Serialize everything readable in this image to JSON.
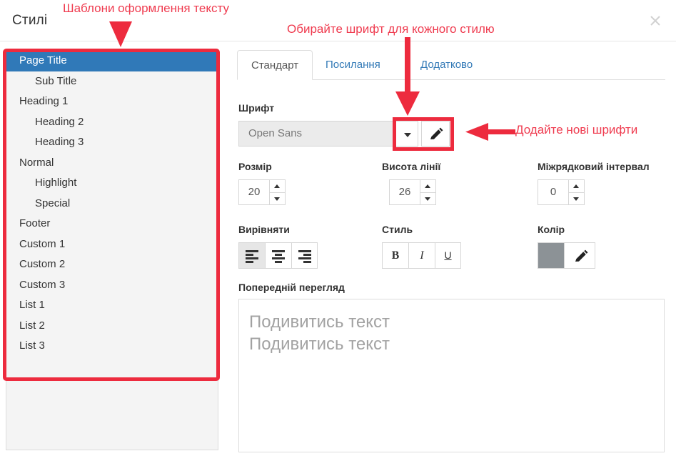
{
  "dialog": {
    "title": "Стилі",
    "close_icon": "close-icon"
  },
  "styles_list": {
    "items": [
      {
        "label": "Page Title",
        "indent": false,
        "selected": true
      },
      {
        "label": "Sub Title",
        "indent": true,
        "selected": false
      },
      {
        "label": "Heading 1",
        "indent": false,
        "selected": false
      },
      {
        "label": "Heading 2",
        "indent": true,
        "selected": false
      },
      {
        "label": "Heading 3",
        "indent": true,
        "selected": false
      },
      {
        "label": "Normal",
        "indent": false,
        "selected": false
      },
      {
        "label": "Highlight",
        "indent": true,
        "selected": false
      },
      {
        "label": "Special",
        "indent": true,
        "selected": false
      },
      {
        "label": "Footer",
        "indent": false,
        "selected": false
      },
      {
        "label": "Custom 1",
        "indent": false,
        "selected": false
      },
      {
        "label": "Custom 2",
        "indent": false,
        "selected": false
      },
      {
        "label": "Custom 3",
        "indent": false,
        "selected": false
      },
      {
        "label": "List 1",
        "indent": false,
        "selected": false
      },
      {
        "label": "List 2",
        "indent": false,
        "selected": false
      },
      {
        "label": "List 3",
        "indent": false,
        "selected": false
      }
    ]
  },
  "tabs": [
    {
      "label": "Стандарт",
      "active": true
    },
    {
      "label": "Посилання",
      "active": false
    },
    {
      "label": "Додатково",
      "active": false
    }
  ],
  "settings": {
    "font": {
      "label": "Шрифт",
      "value": "Open Sans",
      "dropdown_icon": "chevron-down-icon",
      "edit_icon": "pencil-icon"
    },
    "size": {
      "label": "Розмір",
      "value": "20"
    },
    "line_height": {
      "label": "Висота лінії",
      "value": "26"
    },
    "line_spacing": {
      "label": "Міжрядковий інтервал",
      "value": "0"
    },
    "align": {
      "label": "Вирівняти",
      "options": [
        "left",
        "center",
        "right"
      ],
      "selected": "left"
    },
    "style": {
      "label": "Стиль",
      "bold_label": "B",
      "italic_label": "I",
      "underline_label": "U"
    },
    "color": {
      "label": "Колір",
      "value": "#8c9296",
      "edit_icon": "pencil-icon"
    },
    "preview": {
      "label": "Попередній перегляд",
      "line1": "Подивитись текст",
      "line2": "Подивитись текст"
    }
  },
  "annotations": {
    "templates": "Шаблони оформлення тексту",
    "choose_font": "Обирайте шрифт для кожного стилю",
    "add_fonts": "Додайте нові шрифти",
    "accent_color": "#ed2b3e"
  }
}
